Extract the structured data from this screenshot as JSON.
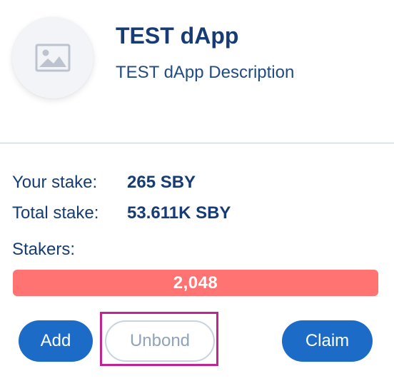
{
  "dapp": {
    "name": "TEST dApp",
    "description": "TEST dApp Description",
    "logo_icon": "image-placeholder-icon"
  },
  "stake": {
    "your_label": "Your stake:",
    "your_value": "265 SBY",
    "total_label": "Total stake:",
    "total_value": "53.611K SBY",
    "stakers_label": "Stakers:",
    "stakers_count": "2,048"
  },
  "actions": {
    "add_label": "Add",
    "unbond_label": "Unbond",
    "claim_label": "Claim"
  },
  "colors": {
    "primary": "#1b6bc7",
    "stakers_bar": "#ff7373",
    "highlight": "#c0268f",
    "text": "#163c73"
  }
}
